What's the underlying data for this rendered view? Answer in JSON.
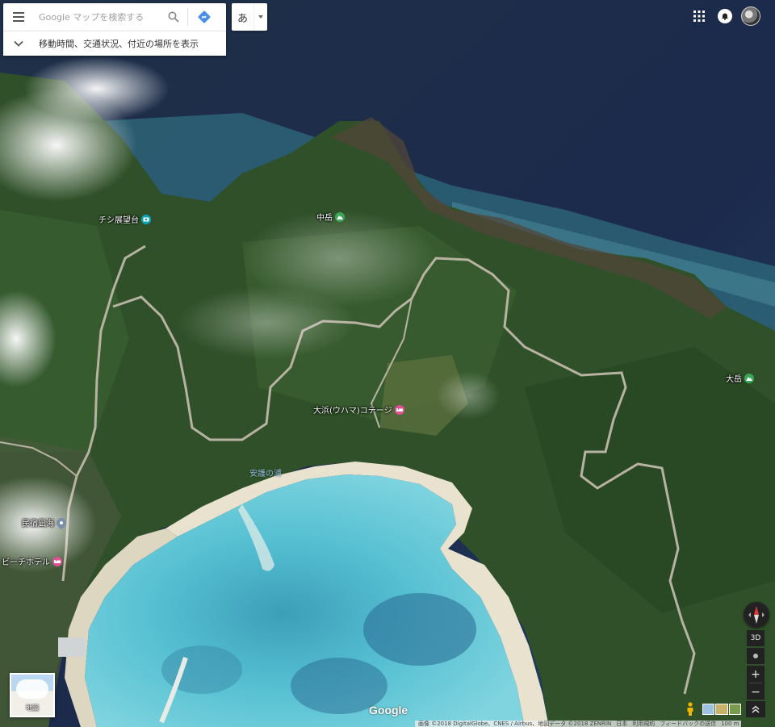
{
  "search": {
    "placeholder": "Google マップを検索する",
    "suggest_text": "移動時間、交通状況、付近の場所を表示"
  },
  "ime": {
    "label": "あ"
  },
  "places": {
    "chishi": "チシ展望台",
    "nakadake": "中岳",
    "oodake": "大岳",
    "uhama": "大浜(ウハマ)コテージ",
    "minshuku": "民宿凪海",
    "beach_hotel": "ビーチホテル",
    "anso": "安護の浦"
  },
  "controls": {
    "three_d": "3D",
    "zoom_in": "+",
    "zoom_out": "−"
  },
  "minimap": {
    "label": "地図"
  },
  "logo": "Google",
  "footer": {
    "imagery": "画像 ©2018 DigitalGlobe、CNES / Airbus、地図データ ©2018 ZENRIN",
    "region": "日本",
    "terms": "利用規約",
    "feedback": "フィードバックの送信",
    "scale": "100 m"
  },
  "colors": {
    "sea_deep": "#1c2e4a",
    "lagoon": "#3fb0c8",
    "forest": "#2f5028",
    "sand": "#e8e2cf",
    "road": "#b8b2a2",
    "pin_green": "#3aa757",
    "pin_teal": "#0fa3b8",
    "pin_pink": "#e05095"
  }
}
